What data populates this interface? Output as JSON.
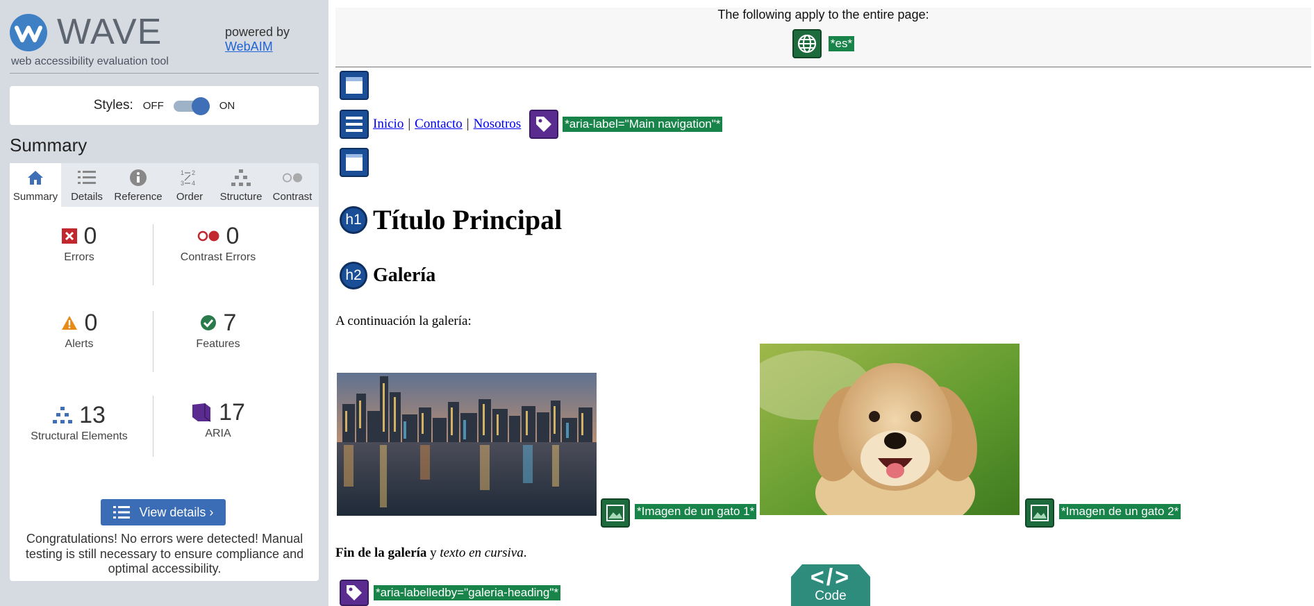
{
  "sidebar": {
    "brand": {
      "name": "WAVE",
      "tagline": "web accessibility evaluation tool",
      "powered_by": "powered by",
      "webaim_link": "WebAIM"
    },
    "styles": {
      "label": "Styles:",
      "off": "OFF",
      "on": "ON",
      "state": "on"
    },
    "summary_title": "Summary",
    "tabs": [
      {
        "label": "Summary",
        "icon": "home-icon",
        "active": true
      },
      {
        "label": "Details",
        "icon": "list-icon"
      },
      {
        "label": "Reference",
        "icon": "info-icon"
      },
      {
        "label": "Order",
        "icon": "order-icon"
      },
      {
        "label": "Structure",
        "icon": "structure-icon"
      },
      {
        "label": "Contrast",
        "icon": "contrast-icon"
      }
    ],
    "stats": {
      "errors": {
        "count": "0",
        "label": "Errors"
      },
      "contrast_errors": {
        "count": "0",
        "label": "Contrast Errors"
      },
      "alerts": {
        "count": "0",
        "label": "Alerts"
      },
      "features": {
        "count": "7",
        "label": "Features"
      },
      "structural": {
        "count": "13",
        "label": "Structural Elements"
      },
      "aria": {
        "count": "17",
        "label": "ARIA"
      }
    },
    "view_details": "View details ›",
    "congrats": "Congratulations! No errors were detected! Manual testing is still necessary to ensure compliance and optimal accessibility."
  },
  "page": {
    "doc_bar": {
      "title": "The following apply to the entire page:",
      "lang_tag": "*es*"
    },
    "nav": {
      "links": [
        "Inicio",
        "Contacto",
        "Nosotros"
      ],
      "separator": "|",
      "aria_tag": "*aria-label=\"Main navigation\"*"
    },
    "h1": {
      "badge": "h1",
      "text": "Título Principal"
    },
    "h2": {
      "badge": "h2",
      "text": "Galería"
    },
    "intro": "A continuación la galería:",
    "images": [
      {
        "alt_tag": "*Imagen de un gato 1*"
      },
      {
        "alt_tag": "*Imagen de un gato 2*"
      }
    ],
    "end_text": {
      "bold": "Fin de la galería",
      "middle": " y ",
      "italic": "texto en cursiva",
      "end": "."
    },
    "aria_labelledby": "*aria-labelledby=\"galeria-heading\"*",
    "code_button": {
      "symbol": "</>",
      "label": "Code"
    }
  },
  "colors": {
    "sidebar_bg": "#d6dbe1",
    "accent_blue": "#3a6db5",
    "feature_green": "#18844a",
    "aria_purple": "#5b2c8f",
    "structure_blue": "#1a4f97",
    "code_teal": "#2e8c7c"
  }
}
